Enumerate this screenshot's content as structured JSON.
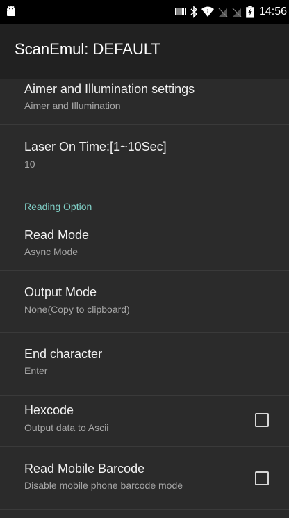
{
  "status_bar": {
    "time": "14:56",
    "icons": [
      "android-icon",
      "barcode-icon",
      "bluetooth-icon",
      "wifi-icon",
      "no-sim-icon",
      "no-sim-icon",
      "battery-charging-icon"
    ]
  },
  "app_bar": {
    "title": "ScanEmul: DEFAULT"
  },
  "preferences": {
    "aimer": {
      "title": "Aimer and Illumination settings",
      "summary": "Aimer and Illumination"
    },
    "laser": {
      "title": "Laser On Time:[1~10Sec]",
      "summary": "10"
    },
    "category_reading": "Reading Option",
    "read_mode": {
      "title": "Read Mode",
      "summary": "Async Mode"
    },
    "output_mode": {
      "title": "Output Mode",
      "summary": "None(Copy to clipboard)"
    },
    "end_char": {
      "title": "End character",
      "summary": "Enter"
    },
    "hexcode": {
      "title": "Hexcode",
      "summary": "Output data to Ascii",
      "checked": false
    },
    "mobile_barcode": {
      "title": "Read Mobile Barcode",
      "summary": "Disable mobile phone barcode mode",
      "checked": false
    }
  },
  "colors": {
    "background": "#2b2b2b",
    "app_bar": "#212121",
    "status_bar": "#000000",
    "category_accent": "#7fcfc6"
  }
}
